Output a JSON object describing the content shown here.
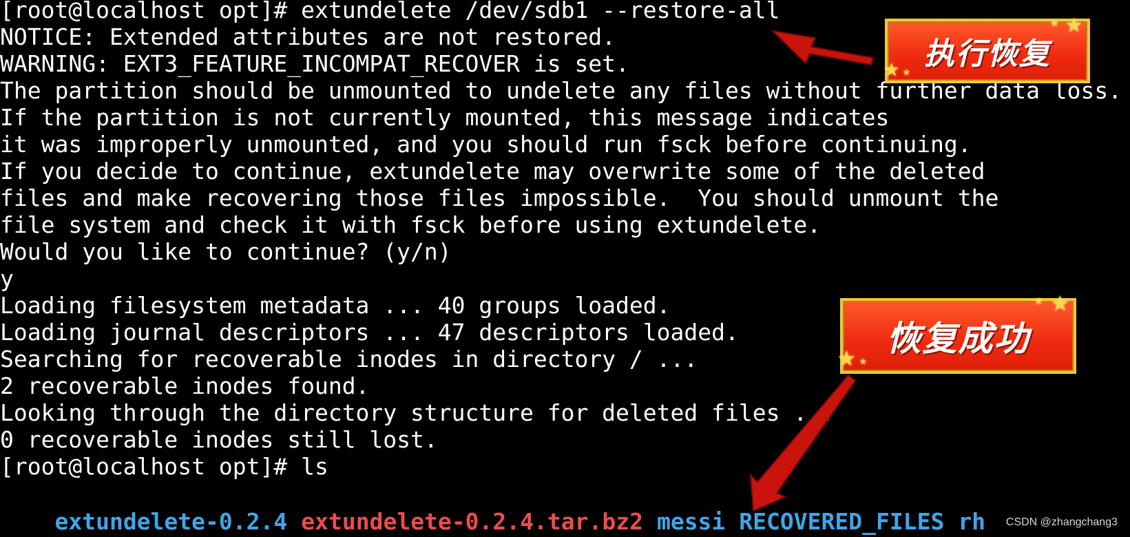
{
  "terminal": {
    "lines": [
      "[root@localhost opt]# extundelete /dev/sdb1 --restore-all",
      "NOTICE: Extended attributes are not restored.",
      "WARNING: EXT3_FEATURE_INCOMPAT_RECOVER is set.",
      "The partition should be unmounted to undelete any files without further data loss.",
      "If the partition is not currently mounted, this message indicates",
      "it was improperly unmounted, and you should run fsck before continuing.",
      "If you decide to continue, extundelete may overwrite some of the deleted",
      "files and make recovering those files impossible.  You should unmount the",
      "file system and check it with fsck before using extundelete.",
      "Would you like to continue? (y/n)",
      "y",
      "Loading filesystem metadata ... 40 groups loaded.",
      "Loading journal descriptors ... 47 descriptors loaded.",
      "Searching for recoverable inodes in directory / ...",
      "2 recoverable inodes found.",
      "Looking through the directory structure for deleted files ...",
      "0 recoverable inodes still lost.",
      "[root@localhost opt]# ls"
    ],
    "ls_output": [
      {
        "name": "extundelete-0.2.4",
        "color": "#3fa6e8"
      },
      {
        "name": "extundelete-0.2.4.tar.bz2",
        "color": "#ee4c4c"
      },
      {
        "name": "messi",
        "color": "#3fa6e8"
      },
      {
        "name": "RECOVERED_FILES",
        "color": "#3fa6e8"
      },
      {
        "name": "rh",
        "color": "#3fa6e8"
      }
    ]
  },
  "annotations": {
    "callout_restore": "执行恢复",
    "callout_success": "恢复成功",
    "arrow_color": "#c8140c"
  },
  "watermark": "CSDN @zhangchang3"
}
